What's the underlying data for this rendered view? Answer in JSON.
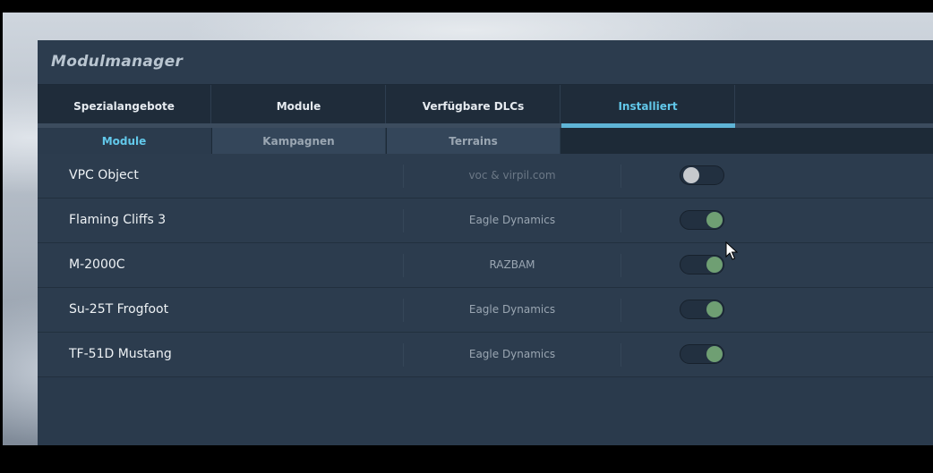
{
  "window": {
    "title": "Modulmanager"
  },
  "tabs": [
    {
      "label": "Spezialangebote",
      "active": false
    },
    {
      "label": "Module",
      "active": false
    },
    {
      "label": "Verfügbare DLCs",
      "active": false
    },
    {
      "label": "Installiert",
      "active": true
    }
  ],
  "subtabs": [
    {
      "label": "Module",
      "active": true
    },
    {
      "label": "Kampagnen",
      "active": false
    },
    {
      "label": "Terrains",
      "active": false
    }
  ],
  "modules": [
    {
      "name": "VPC Object",
      "vendor": "voc & virpil.com",
      "enabled": false
    },
    {
      "name": "Flaming Cliffs 3",
      "vendor": "Eagle Dynamics",
      "enabled": true
    },
    {
      "name": "M-2000C",
      "vendor": "RAZBAM",
      "enabled": true
    },
    {
      "name": "Su-25T Frogfoot",
      "vendor": "Eagle Dynamics",
      "enabled": true
    },
    {
      "name": "TF-51D Mustang",
      "vendor": "Eagle Dynamics",
      "enabled": true
    }
  ],
  "colors": {
    "accent": "#62c8ea",
    "toggle_on": "#6f9f73",
    "panel": "#2c3c4e"
  }
}
